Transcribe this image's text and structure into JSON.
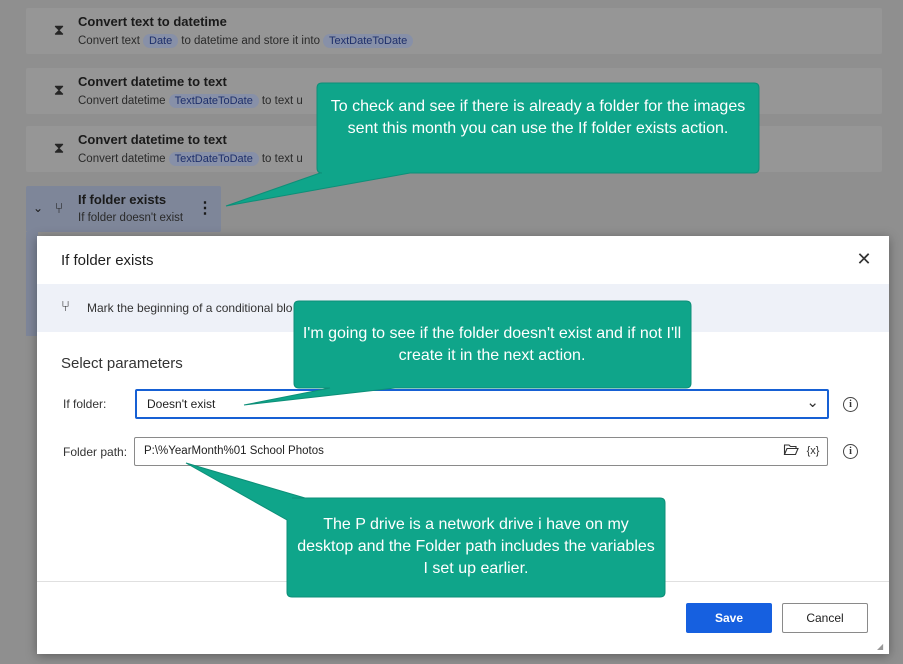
{
  "background_flow": {
    "actions": [
      {
        "title": "Convert text to datetime",
        "desc_parts": [
          "Convert text",
          "Date",
          "to datetime and store it into",
          "TextDateToDate"
        ]
      },
      {
        "title": "Convert datetime to text",
        "desc_parts": [
          "Convert datetime",
          "TextDateToDate",
          "to text u"
        ]
      },
      {
        "title": "Convert datetime to text",
        "desc_parts": [
          "Convert datetime",
          "TextDateToDate",
          "to text u"
        ]
      }
    ],
    "selected_action": {
      "title": "If folder exists",
      "desc": "If folder  doesn't exist"
    }
  },
  "dialog": {
    "title": "If folder exists",
    "info_text": "Mark the beginning of a conditional blo",
    "section_title": "Select parameters",
    "if_folder": {
      "label": "If folder:",
      "value": "Doesn't exist"
    },
    "folder_path": {
      "label": "Folder path:",
      "value": "P:\\%YearMonth%01 School Photos",
      "var_button": "{x}"
    },
    "save_label": "Save",
    "cancel_label": "Cancel"
  },
  "callouts": {
    "c1": "To check and see if there is already a folder for the images sent this month you can use the If folder exists action.",
    "c2": "I'm going to see if the folder doesn't exist and if not I'll create it in the next action.",
    "c3": "The P drive is a network drive i have on my desktop and the Folder path includes the variables I set up earlier."
  },
  "colors": {
    "callout": "#0fa58a",
    "primary": "#1660e0",
    "variable_chip": "#1e2f6b"
  },
  "icons": [
    "convert-icon",
    "if-folder-icon",
    "chevron-down-icon",
    "more-icon",
    "close-icon",
    "info-icon",
    "folder-open-icon",
    "variables-icon"
  ]
}
